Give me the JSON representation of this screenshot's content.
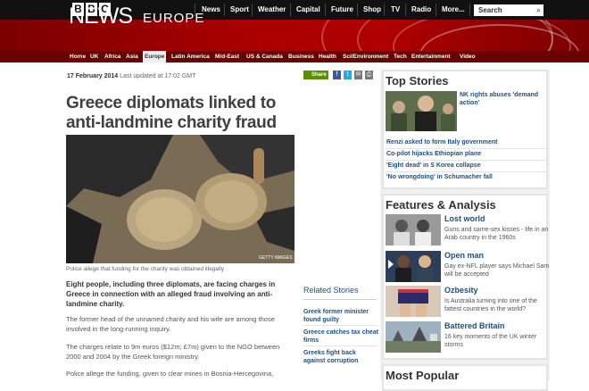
{
  "global_nav": {
    "items": [
      "News",
      "Sport",
      "Weather",
      "Capital",
      "Future",
      "Shop",
      "TV",
      "Radio",
      "More..."
    ],
    "search_placeholder": "Search"
  },
  "masthead": {
    "title": "NEWS",
    "edition": "EUROPE"
  },
  "section_nav": {
    "items": [
      "Home",
      "UK",
      "Africa",
      "Asia",
      "Europe",
      "Latin America",
      "Mid-East",
      "US & Canada",
      "Business",
      "Health",
      "Sci/Environment",
      "Tech",
      "Entertainment",
      "Video"
    ],
    "active": "Europe"
  },
  "article": {
    "date": "17 February 2014",
    "updated": "Last updated at 17:02 GMT",
    "share_label": "Share",
    "headline": "Greece diplomats linked to anti-landmine charity fraud scandal",
    "image_credit": "GETTY IMAGES",
    "caption": "Police allege that funding for the charity was obtained illegally",
    "lead": "Eight people, including three diplomats, are facing charges in Greece in connection with an alleged fraud involving an anti-landmine charity.",
    "paragraphs": [
      "The former head of the unnamed charity and his wife are among those involved in the long-running inquiry.",
      "The charges relate to 9m euros ($12m; £7m) given to the NGO between 2000 and 2004 by the Greek foreign ministry.",
      "Police allege the funding, given to clear mines in Bosnia-Hercegovina,"
    ]
  },
  "related": {
    "title": "Related Stories",
    "items": [
      "Greek former minister found guilty",
      "Greece catches tax cheat firms",
      "Greeks fight back against corruption"
    ]
  },
  "top_stories": {
    "title": "Top Stories",
    "lead": "NK rights abuses 'demand action'",
    "items": [
      "Renzi asked to form Italy government",
      "Co-pilot hijacks Ethiopian plane",
      "'Eight dead' in S Korea collapse",
      "'No wrongdoing' in Schumacher fall"
    ]
  },
  "features": {
    "title": "Features & Analysis",
    "items": [
      {
        "title": "Lost world",
        "text": "Guns and same-sex kisses - life in an Arab country in the 1960s"
      },
      {
        "title": "Open man",
        "text": "Gay ex-NFL player says Michael Sam will be accepted"
      },
      {
        "title": "Ozbesity",
        "text": "Is Australia turning into one of the fattest countries in the world?"
      },
      {
        "title": "Battered Britain",
        "text": "16 key moments of the UK winter storms"
      }
    ]
  },
  "most_popular": {
    "title": "Most Popular"
  },
  "colors": {
    "brand_red": "#b00000",
    "link_blue": "#1f4f82",
    "share_green": "#5a8f00"
  }
}
